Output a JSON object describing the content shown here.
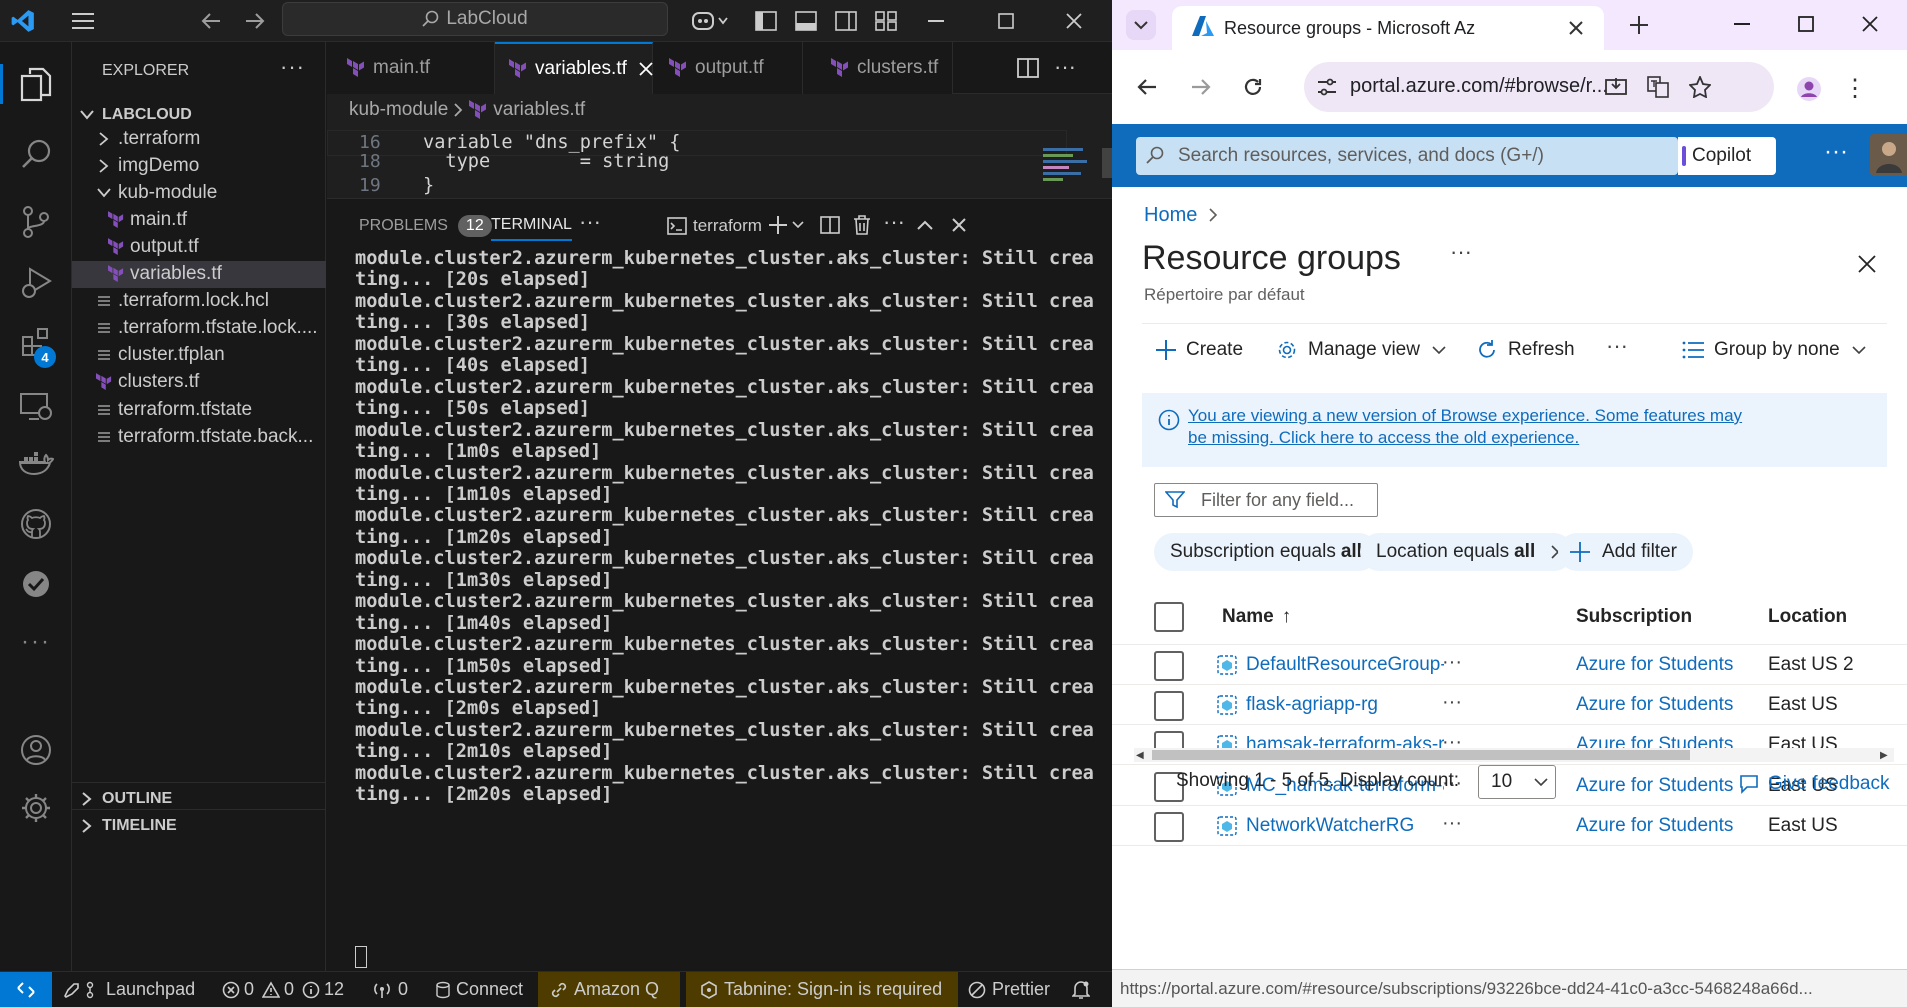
{
  "vscode": {
    "search": "LabCloud",
    "explorer": {
      "title": "EXPLORER",
      "root": "LABCLOUD",
      "items": [
        {
          "label": ".terraform",
          "kind": "folder"
        },
        {
          "label": "imgDemo",
          "kind": "folder"
        },
        {
          "label": "kub-module",
          "kind": "folder-open"
        },
        {
          "label": "main.tf",
          "kind": "tf"
        },
        {
          "label": "output.tf",
          "kind": "tf"
        },
        {
          "label": "variables.tf",
          "kind": "tf"
        },
        {
          "label": ".terraform.lock.hcl",
          "kind": "file"
        },
        {
          "label": ".terraform.tfstate.lock....",
          "kind": "file"
        },
        {
          "label": "cluster.tfplan",
          "kind": "file"
        },
        {
          "label": "clusters.tf",
          "kind": "tf"
        },
        {
          "label": "terraform.tfstate",
          "kind": "file"
        },
        {
          "label": "terraform.tfstate.back...",
          "kind": "file"
        }
      ],
      "outline": "OUTLINE",
      "timeline": "TIMELINE"
    },
    "extensions_badge": "4",
    "tabs": [
      "main.tf",
      "variables.tf",
      "output.tf",
      "clusters.tf"
    ],
    "breadcrumb": {
      "folder": "kub-module",
      "file": "variables.tf"
    },
    "code": [
      {
        "line": "16",
        "text": "variable \"dns_prefix\" {"
      },
      {
        "line": "18",
        "text": "  type        = string"
      },
      {
        "line": "19",
        "text": "}"
      }
    ],
    "panel": {
      "problems": "PROBLEMS",
      "problems_count": "12",
      "terminal": "TERMINAL",
      "terminal_name": "terraform"
    },
    "terminal_lines": [
      "module.cluster2.azurerm_kubernetes_cluster.aks_cluster: Still crea",
      "ting... [20s elapsed]",
      "module.cluster2.azurerm_kubernetes_cluster.aks_cluster: Still crea",
      "ting... [30s elapsed]",
      "module.cluster2.azurerm_kubernetes_cluster.aks_cluster: Still crea",
      "ting... [40s elapsed]",
      "module.cluster2.azurerm_kubernetes_cluster.aks_cluster: Still crea",
      "ting... [50s elapsed]",
      "module.cluster2.azurerm_kubernetes_cluster.aks_cluster: Still crea",
      "ting... [1m0s elapsed]",
      "module.cluster2.azurerm_kubernetes_cluster.aks_cluster: Still crea",
      "ting... [1m10s elapsed]",
      "module.cluster2.azurerm_kubernetes_cluster.aks_cluster: Still crea",
      "ting... [1m20s elapsed]",
      "module.cluster2.azurerm_kubernetes_cluster.aks_cluster: Still crea",
      "ting... [1m30s elapsed]",
      "module.cluster2.azurerm_kubernetes_cluster.aks_cluster: Still crea",
      "ting... [1m40s elapsed]",
      "module.cluster2.azurerm_kubernetes_cluster.aks_cluster: Still crea",
      "ting... [1m50s elapsed]",
      "module.cluster2.azurerm_kubernetes_cluster.aks_cluster: Still crea",
      "ting... [2m0s elapsed]",
      "module.cluster2.azurerm_kubernetes_cluster.aks_cluster: Still crea",
      "ting... [2m10s elapsed]",
      "module.cluster2.azurerm_kubernetes_cluster.aks_cluster: Still crea",
      "ting... [2m20s elapsed]"
    ],
    "status": {
      "launchpad": "Launchpad",
      "errors": "0",
      "warnings": "0",
      "infos": "12",
      "ports": "0",
      "connect": "Connect",
      "amazonq": "Amazon Q",
      "tabnine": "Tabnine: Sign-in is required",
      "prettier": "Prettier"
    },
    "colors": {
      "accent": "#0078d4",
      "statusRemote": "#0078d4",
      "terraform": "#844fba",
      "highlight": "#4d3b00"
    }
  },
  "browser": {
    "tab_title": "Resource groups - Microsoft Az",
    "url": "portal.azure.com/#browse/r...",
    "azure": {
      "search_placeholder": "Search resources, services, and docs (G+/)",
      "copilot": "Copilot",
      "breadcrumb_home": "Home",
      "title": "Resource groups",
      "subtitle": "Répertoire par défaut",
      "toolbar": {
        "create": "Create",
        "manage_view": "Manage view",
        "refresh": "Refresh",
        "group_by": "Group by none"
      },
      "info_banner": "You are viewing a new version of Browse experience. Some features may be missing. Click here to access the old experience.",
      "filter_placeholder": "Filter for any field...",
      "filters": [
        {
          "prefix": "Subscription equals ",
          "value": "all"
        },
        {
          "prefix": "Location equals ",
          "value": "all"
        }
      ],
      "add_filter": "Add filter",
      "columns": {
        "name": "Name",
        "sort": "↑",
        "subscription": "Subscription",
        "location": "Location"
      },
      "rows": [
        {
          "name": "DefaultResourceGroup-ea...",
          "subscription": "Azure for Students",
          "location": "East US 2"
        },
        {
          "name": "flask-agriapp-rg",
          "subscription": "Azure for Students",
          "location": "East US"
        },
        {
          "name": "hamsak-terraform-aks-rg",
          "subscription": "Azure for Students",
          "location": "East US"
        },
        {
          "name": "MC_hamsak-terraform-ak...",
          "subscription": "Azure for Students",
          "location": "East US"
        },
        {
          "name": "NetworkWatcherRG",
          "subscription": "Azure for Students",
          "location": "East US"
        }
      ],
      "showing": "Showing 1 - 5 of 5. Display count:",
      "display_count": "10",
      "feedback": "Give feedback",
      "status_url": "https://portal.azure.com/#resource/subscriptions/93226bce-dd24-41c0-a3cc-5468248a66d..."
    },
    "colors": {
      "azureBlue": "#0f6cbd",
      "tabStrip": "#f3e8fd"
    }
  }
}
